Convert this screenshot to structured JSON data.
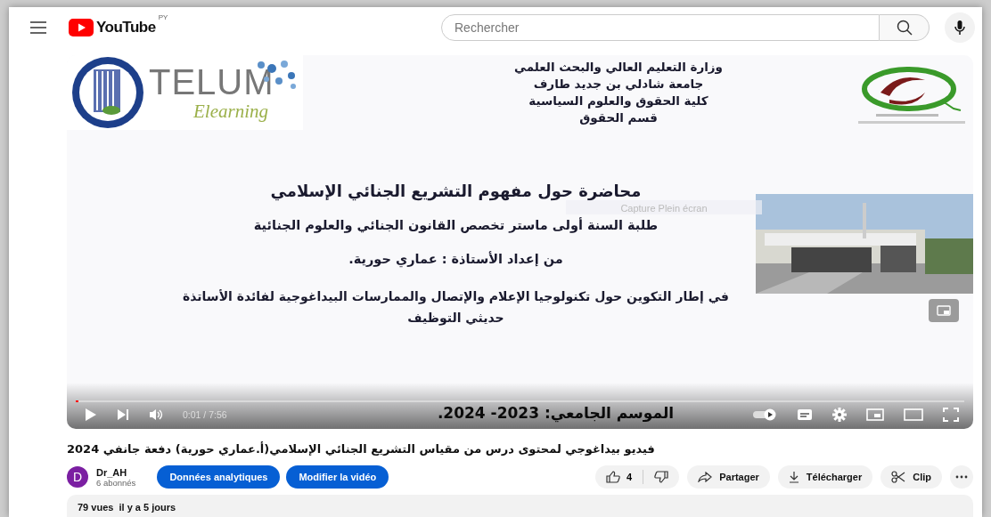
{
  "header": {
    "logo": "YouTube",
    "region": "PY",
    "search": {
      "placeholder": "Rechercher"
    }
  },
  "video": {
    "slide": {
      "brand": {
        "name": "TELUM",
        "tagline": "Elearning"
      },
      "header_lines": [
        "وزارة التعليم العالي والبحث العلمي",
        "جامعة شادلي بن جديد طارف",
        "كلية الحقوق والعلوم السياسية",
        "قسم الحقوق"
      ],
      "title": "محاضرة حول  مفهوم التشريع الجنائي الإسلامي",
      "lines": [
        "طلبة السنة أولى ماستر تخصص القانون الجنائي والعلوم الجنائية",
        "من إعداد الأستاذة :  عماري حورية.",
        "في إطار التكوين  حول تكنولوجيا الإعلام والإتصال  والممارسات البيداغوجية لفائدة الأساتذة حديثي التوظيف"
      ],
      "season": "الموسم الجامعي: 2023- 2024."
    },
    "tooltip": "Capture Plein écran",
    "progress": {
      "level": 0.003
    },
    "time": "0:01 / 7:56",
    "autoplay": {
      "on": true
    }
  },
  "title": "فيديو بيداغوجي لمحتوى درس من مقياس التشريع الجنائي الإسلامي(أ.عماري حورية) دفعة جانفي 2024",
  "channel": {
    "avatar": "D",
    "name": "Dr_AH",
    "subscribers": "6 abonnés"
  },
  "owner_buttons": {
    "analytics": "Données analytiques",
    "edit": "Modifier la vidéo"
  },
  "actions": {
    "likes": "4",
    "share": "Partager",
    "download": "Télécharger",
    "clip": "Clip"
  },
  "description": {
    "stats": "79 vues  il y a 5 jours"
  }
}
